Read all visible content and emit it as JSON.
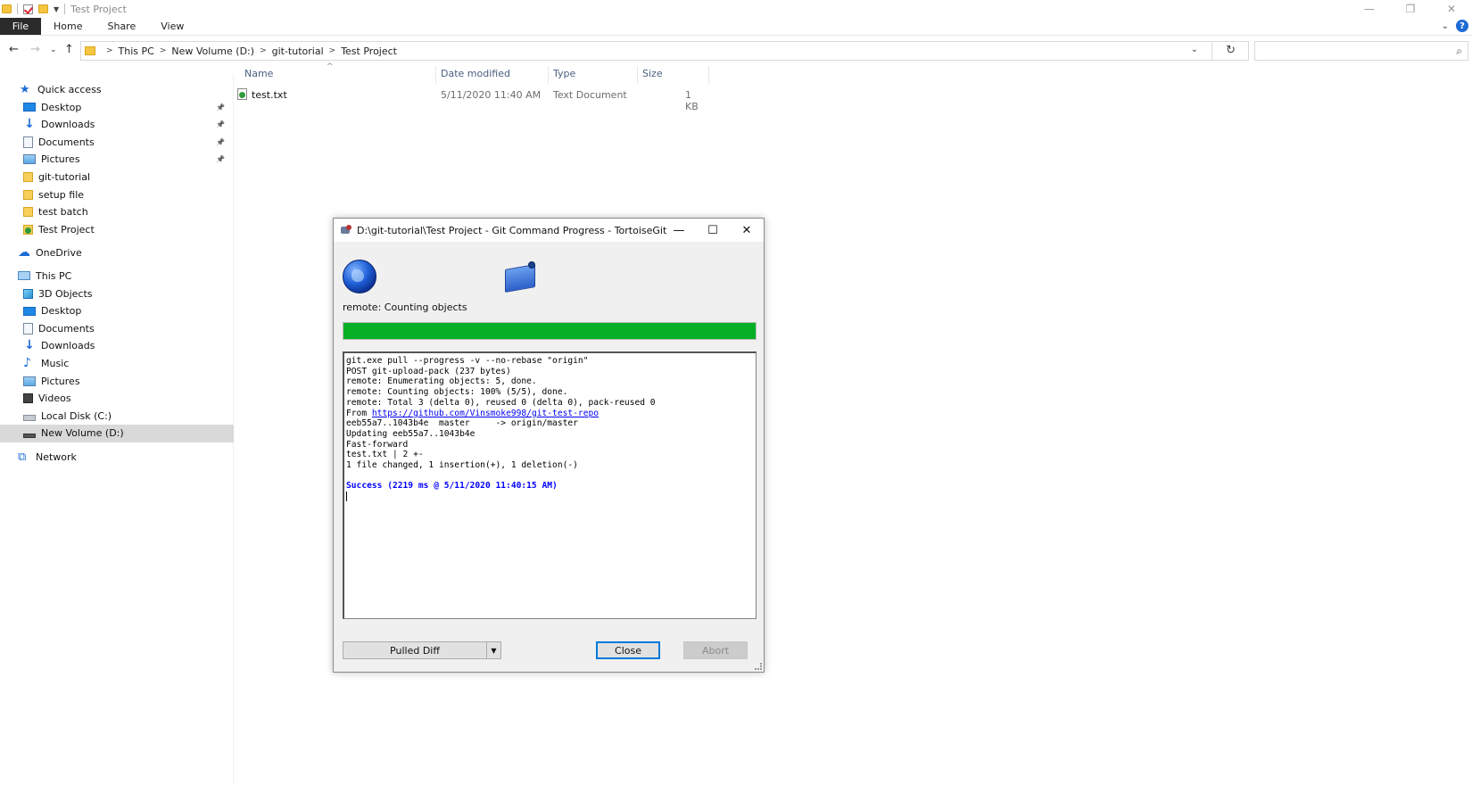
{
  "window": {
    "title": "Test Project",
    "controls": {
      "minimize": "—",
      "restore": "❐",
      "close": "✕"
    }
  },
  "ribbon": {
    "tabs": [
      "File",
      "Home",
      "Share",
      "View"
    ],
    "help": "?"
  },
  "address": {
    "crumbs": [
      "This PC",
      "New Volume (D:)",
      "git-tutorial",
      "Test Project"
    ],
    "search_placeholder": ""
  },
  "sidebar": {
    "quick_access": "Quick access",
    "quick_items": [
      {
        "label": "Desktop",
        "icon": "desktop-icon",
        "pinned": true
      },
      {
        "label": "Downloads",
        "icon": "download-icon",
        "pinned": true
      },
      {
        "label": "Documents",
        "icon": "document-icon",
        "pinned": true
      },
      {
        "label": "Pictures",
        "icon": "pictures-icon",
        "pinned": true
      },
      {
        "label": "git-tutorial",
        "icon": "folder-icon",
        "pinned": false
      },
      {
        "label": "setup file",
        "icon": "folder-icon",
        "pinned": false
      },
      {
        "label": "test batch",
        "icon": "folder-icon",
        "pinned": false
      },
      {
        "label": "Test Project",
        "icon": "git-folder-icon",
        "pinned": false
      }
    ],
    "onedrive": "OneDrive",
    "this_pc": "This PC",
    "pc_items": [
      {
        "label": "3D Objects",
        "icon": "cube-icon"
      },
      {
        "label": "Desktop",
        "icon": "desktop-icon"
      },
      {
        "label": "Documents",
        "icon": "document-icon"
      },
      {
        "label": "Downloads",
        "icon": "download-icon"
      },
      {
        "label": "Music",
        "icon": "music-icon"
      },
      {
        "label": "Pictures",
        "icon": "pictures-icon"
      },
      {
        "label": "Videos",
        "icon": "video-icon"
      },
      {
        "label": "Local Disk (C:)",
        "icon": "disk-icon"
      },
      {
        "label": "New Volume (D:)",
        "icon": "drive-icon",
        "selected": true
      }
    ],
    "network": "Network"
  },
  "filelist": {
    "columns": {
      "name": "Name",
      "date": "Date modified",
      "type": "Type",
      "size": "Size"
    },
    "files": [
      {
        "name": "test.txt",
        "date": "5/11/2020 11:40 AM",
        "type": "Text Document",
        "size": "1 KB"
      }
    ]
  },
  "dialog": {
    "title": "D:\\git-tutorial\\Test Project - Git Command Progress - TortoiseGit",
    "status": "remote: Counting objects",
    "progress": 1.0,
    "progress_color": "#06b025",
    "log": {
      "line1": "git.exe pull --progress -v --no-rebase \"origin\"",
      "line2": "POST git-upload-pack (237 bytes)",
      "line3": "remote: Enumerating objects: 5, done.",
      "line4": "remote: Counting objects: 100% (5/5), done.",
      "line5": "remote: Total 3 (delta 0), reused 0 (delta 0), pack-reused 0",
      "from_prefix": "From ",
      "from_url": "https://github.com/Vinsmoke998/git-test-repo",
      "line7": "eeb55a7..1043b4e  master     -> origin/master",
      "line8": "Updating eeb55a7..1043b4e",
      "line9": "Fast-forward",
      "line10": "test.txt | 2 +-",
      "line11": "1 file changed, 1 insertion(+), 1 deletion(-)",
      "success": "Success (2219 ms @ 5/11/2020 11:40:15 AM)"
    },
    "buttons": {
      "pulled_diff": "Pulled Diff",
      "close": "Close",
      "abort": "Abort"
    }
  }
}
